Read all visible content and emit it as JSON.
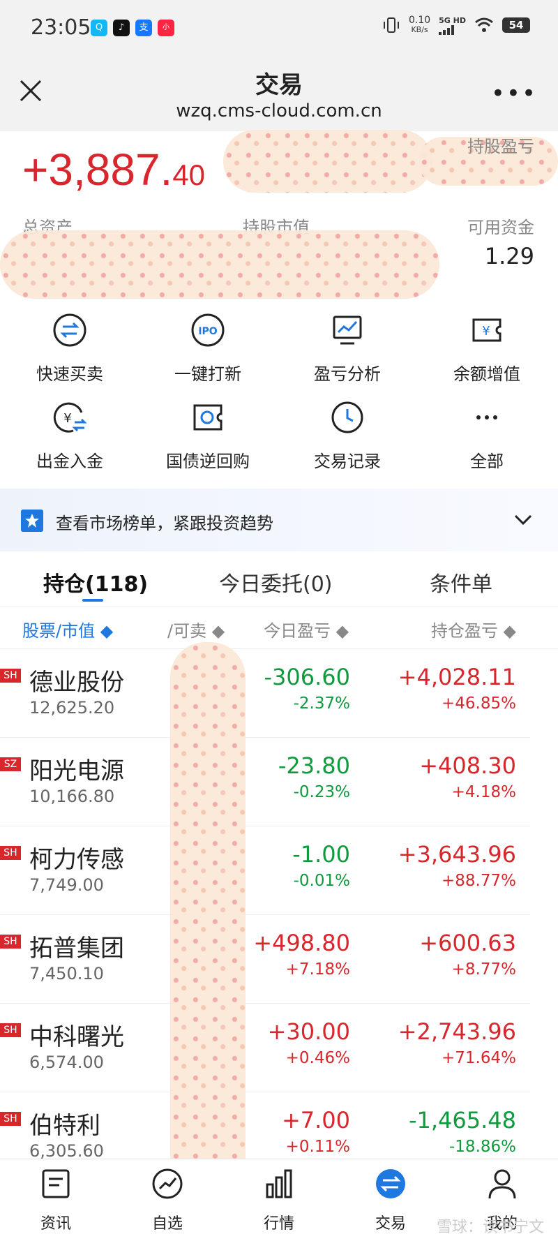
{
  "status_bar": {
    "time": "23:05",
    "net_speed": "0.10",
    "net_unit": "KB/s",
    "network": "5G HD",
    "battery": "54",
    "apps": [
      {
        "name": "qq-icon",
        "color": "#12b7f5",
        "glyph": "Q"
      },
      {
        "name": "douyin-icon",
        "color": "#111111",
        "glyph": "♪"
      },
      {
        "name": "alipay-icon",
        "color": "#1677ff",
        "glyph": "支"
      },
      {
        "name": "xiaohongshu-icon",
        "color": "#ff2442",
        "glyph": "小"
      }
    ]
  },
  "nav": {
    "title": "交易",
    "url": "wzq.cms-cloud.com.cn",
    "more": "•••"
  },
  "summary": {
    "profit_main": "+3,887.",
    "profit_decimal": "40",
    "holding_pl_label": "持股盈亏",
    "total_assets_label": "总资产",
    "market_value_label": "持股市值",
    "cash_label": "可用资金",
    "cash_value": "1.29"
  },
  "actions": [
    {
      "label": "快速买卖",
      "icon": "swap-circle-icon"
    },
    {
      "label": "一键打新",
      "icon": "ipo-icon"
    },
    {
      "label": "盈亏分析",
      "icon": "chart-monitor-icon"
    },
    {
      "label": "余额增值",
      "icon": "yuan-ticket-icon"
    },
    {
      "label": "出金入金",
      "icon": "yuan-transfer-icon"
    },
    {
      "label": "国债逆回购",
      "icon": "reverse-repo-icon"
    },
    {
      "label": "交易记录",
      "icon": "clock-icon"
    },
    {
      "label": "全部",
      "icon": "more-dots-icon"
    }
  ],
  "banner": {
    "text": "查看市场榜单，紧跟投资趋势"
  },
  "tabs": [
    {
      "label": "持仓(118)",
      "active": true
    },
    {
      "label": "今日委托(0)",
      "active": false
    },
    {
      "label": "条件单",
      "active": false
    }
  ],
  "columns": {
    "stock": "股票/市值 ◆",
    "sellable": "/可卖 ◆",
    "today_pl": "今日盈亏 ◆",
    "hold_pl": "持仓盈亏 ◆"
  },
  "holdings": [
    {
      "market": "SH",
      "name": "德业股份",
      "value": "12,625.20",
      "today": "-306.60",
      "today_pct": "-2.37%",
      "today_dir": "down",
      "hold": "+4,028.11",
      "hold_pct": "+46.85%",
      "hold_dir": "up"
    },
    {
      "market": "SZ",
      "name": "阳光电源",
      "value": "10,166.80",
      "today": "-23.80",
      "today_pct": "-0.23%",
      "today_dir": "down",
      "hold": "+408.30",
      "hold_pct": "+4.18%",
      "hold_dir": "up"
    },
    {
      "market": "SH",
      "name": "柯力传感",
      "value": "7,749.00",
      "today": "-1.00",
      "today_pct": "-0.01%",
      "today_dir": "down",
      "hold": "+3,643.96",
      "hold_pct": "+88.77%",
      "hold_dir": "up"
    },
    {
      "market": "SH",
      "name": "拓普集团",
      "value": "7,450.10",
      "today": "+498.80",
      "today_pct": "+7.18%",
      "today_dir": "up",
      "hold": "+600.63",
      "hold_pct": "+8.77%",
      "hold_dir": "up"
    },
    {
      "market": "SH",
      "name": "中科曙光",
      "value": "6,574.00",
      "today": "+30.00",
      "today_pct": "+0.46%",
      "today_dir": "up",
      "hold": "+2,743.96",
      "hold_pct": "+71.64%",
      "hold_dir": "up"
    },
    {
      "market": "SH",
      "name": "伯特利",
      "value": "6,305.60",
      "today": "+7.00",
      "today_pct": "+0.11%",
      "today_dir": "up",
      "hold": "-1,465.48",
      "hold_pct": "-18.86%",
      "hold_dir": "down"
    }
  ],
  "bottom_nav": [
    {
      "label": "资讯",
      "icon": "news-icon"
    },
    {
      "label": "自选",
      "icon": "watchlist-icon"
    },
    {
      "label": "行情",
      "icon": "market-bars-icon"
    },
    {
      "label": "交易",
      "icon": "trade-icon",
      "active": true
    },
    {
      "label": "我的",
      "icon": "profile-icon"
    }
  ],
  "watermark": "雪球：读书宁文",
  "colors": {
    "up": "#d7262c",
    "down": "#0f9a3d",
    "accent": "#1e78e0"
  }
}
